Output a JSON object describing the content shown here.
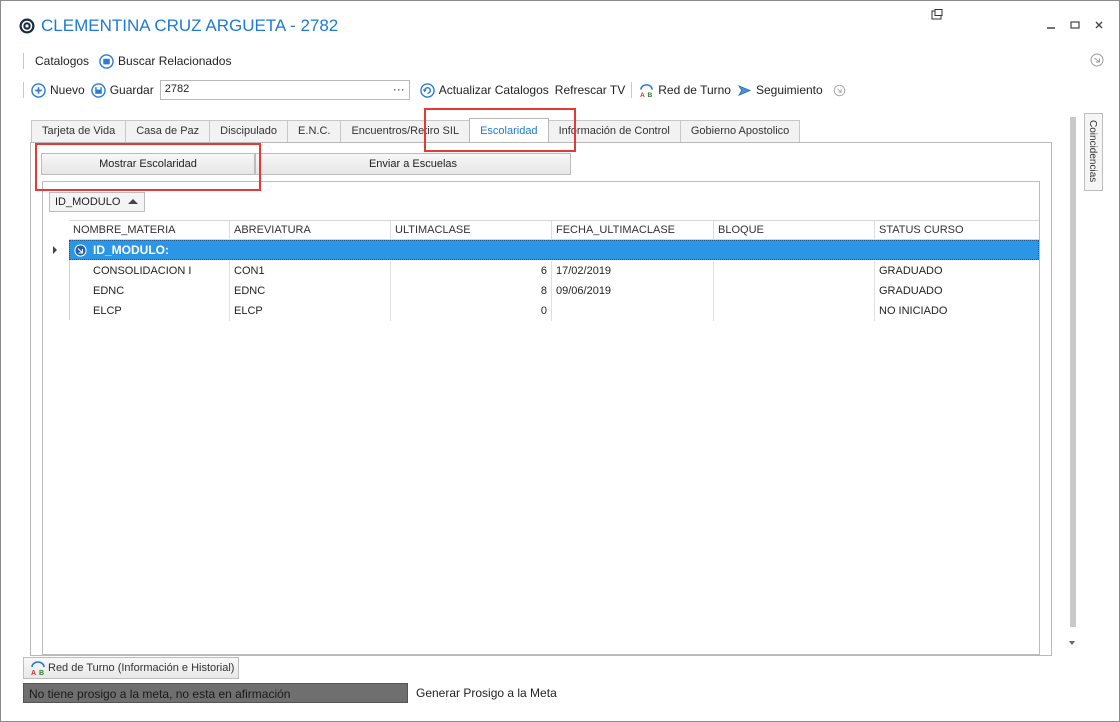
{
  "window": {
    "title": "CLEMENTINA CRUZ ARGUETA - 2782"
  },
  "menu": {
    "catalogos": "Catalogos",
    "buscar_relacionados": "Buscar Relacionados"
  },
  "toolbar": {
    "nuevo": "Nuevo",
    "guardar": "Guardar",
    "search_value": "2782",
    "dots": "···",
    "actualizar": "Actualizar Catalogos",
    "refrescar": "Refrescar TV",
    "red_turno": "Red de Turno",
    "seguimiento": "Seguimiento"
  },
  "tabs": [
    {
      "label": "Tarjeta de Vida"
    },
    {
      "label": "Casa de Paz"
    },
    {
      "label": "Discipulado"
    },
    {
      "label": "E.N.C."
    },
    {
      "label": "Encuentros/Retiro SIL"
    },
    {
      "label": "Escolaridad"
    },
    {
      "label": "Información de Control"
    },
    {
      "label": "Gobierno Apostolico"
    }
  ],
  "active_tab": "Escolaridad",
  "buttons": {
    "mostrar": "Mostrar Escolaridad",
    "enviar": "Enviar a Escuelas"
  },
  "grid": {
    "group_by": "ID_MODULO",
    "columns": [
      "NOMBRE_MATERIA",
      "ABREVIATURA",
      "ULTIMACLASE",
      "FECHA_ULTIMACLASE",
      "BLOQUE",
      "STATUS CURSO"
    ],
    "group_row_label": "ID_MODULO:",
    "rows": [
      {
        "nombre": "CONSOLIDACION I",
        "abrev": "CON1",
        "ultima": "6",
        "fecha": "17/02/2019",
        "bloque": "",
        "status": "GRADUADO"
      },
      {
        "nombre": "EDNC",
        "abrev": "EDNC",
        "ultima": "8",
        "fecha": "09/06/2019",
        "bloque": "",
        "status": "GRADUADO"
      },
      {
        "nombre": "ELCP",
        "abrev": "ELCP",
        "ultima": "0",
        "fecha": "",
        "bloque": "",
        "status": "NO INICIADO"
      }
    ]
  },
  "side_panel": {
    "label": "Coincidencias"
  },
  "bottom": {
    "red_turno_button": "Red de Turno (Información e Historial)",
    "status": "No tiene prosigo a la meta, no esta en afirmación",
    "generar": "Generar Prosigo a la Meta"
  },
  "colors": {
    "accent": "#1e7ad6",
    "selection": "#2b96e6",
    "highlight": "#e53935",
    "status_bg": "#6f6f6f"
  }
}
